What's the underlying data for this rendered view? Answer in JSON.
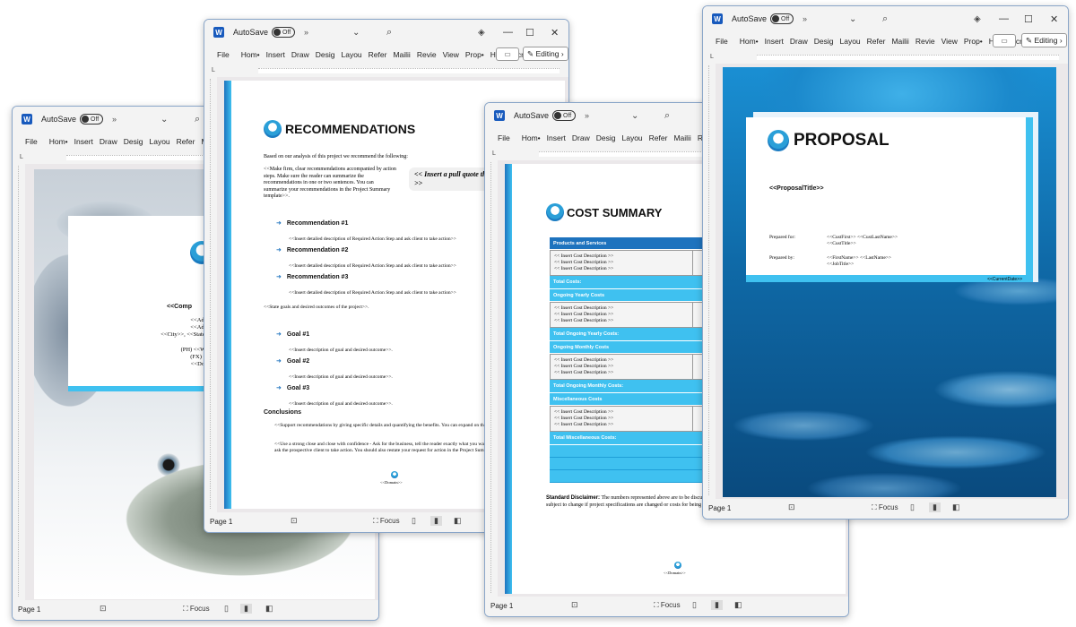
{
  "app": {
    "autosave_label": "AutoSave",
    "autosave_state": "Off",
    "ribbon_tabs": [
      "File",
      "Hom•",
      "Insert",
      "Draw",
      "Desig",
      "Layou",
      "Refer",
      "Mailii",
      "Revie",
      "View",
      "Prop•",
      "Help",
      "Acrol"
    ],
    "editing_label": "Editing",
    "status_page": "Page 1",
    "focus_label": "Focus",
    "accent": "#1e73be",
    "accent_light": "#3fc1f0"
  },
  "windows": {
    "cover": {
      "company": "<<Comp",
      "address_lines": [
        "<<Addre",
        "<<Addre",
        "<<City>>, <<State>>"
      ],
      "contact_lines": [
        "(PH) <<Worl",
        "(FX) <<I",
        "<<Doma"
      ]
    },
    "recommendations": {
      "title": "RECOMMENDATIONS",
      "intro": "Based on our analysis of this project we recommend the following:",
      "paragraph": "<<Make firm, clear recommendations accompanied by action steps.  Make sure the reader can summarize the recommendations in one or two sentences.  You can summarize your recommendations in the Project Summary template>>.",
      "pull_quote": "<< Insert a pull quote that will be in emphasis text >>",
      "recommendations": [
        {
          "label": "Recommendation #1",
          "desc": "<<Insert detailed description of Required Action Step and ask client to take action>>"
        },
        {
          "label": "Recommendation #2",
          "desc": "<<Insert detailed description of Required Action Step and ask client to take action>>"
        },
        {
          "label": "Recommendation #3",
          "desc": "<<Insert detailed description of Required Action Step and ask client to take action>>"
        }
      ],
      "goals_intro": "<<State goals and desired outcomes of the project>>.",
      "goals": [
        {
          "label": "Goal #1",
          "desc": "<<Insert description of goal and desired outcome>>."
        },
        {
          "label": "Goal #2",
          "desc": "<<Insert description of goal and desired outcome>>."
        },
        {
          "label": "Goal #3",
          "desc": "<<Insert description of goal and desired outcome>>."
        }
      ],
      "conclusions_heading": "Conclusions",
      "conclusion_1": "<<Support recommendations by giving specific details and quantifying the benefits.  You can expand on the benefits by adding the Benefits template>>.",
      "conclusion_2": "<<Use a strong close and close with confidence - Ask for the business, tell the reader exactly what you want him or her to do.  Many proposals forget to ask the prospective client to take action. You should also restate your request for action in the Project Summary template>>.",
      "domain": "<<Domain>>"
    },
    "cost_summary": {
      "title": "COST SUMMARY",
      "sections": [
        {
          "header": "Products and Services",
          "items": [
            "<< Insert Cost Description >>",
            "<< Insert Cost Description >>",
            "<< Insert Cost Description >>"
          ],
          "total": "Total Costs:"
        },
        {
          "header": "Ongoing Yearly Costs",
          "items": [
            "<< Insert Cost Description >>",
            "<< Insert Cost Description >>",
            "<< Insert Cost Description >>"
          ],
          "total": "Total Ongoing Yearly Costs:"
        },
        {
          "header": "Ongoing Monthly Costs",
          "items": [
            "<< Insert Cost Description >>",
            "<< Insert Cost Description >>",
            "<< Insert Cost Description >>"
          ],
          "total": "Total Ongoing Monthly Costs:"
        },
        {
          "header": "Miscellaneous Costs",
          "items": [
            "<< Insert Cost Description >>",
            "<< Insert Cost Description >>",
            "<< Insert Cost Description >>"
          ],
          "total": "Total Miscellaneous Costs:"
        }
      ],
      "disclaimer_label": "Standard Disclaimer:",
      "disclaimer_text": "The numbers represented above are to be discussed. The above Cost Summary does in no way constitute a w subject to change if project specifications are changed or costs for being locked in by a binding contract.",
      "domain": "<<Domain>>"
    },
    "proposal": {
      "title": "PROPOSAL",
      "proposal_title": "<<ProposalTitle>>",
      "prepared_for_label": "Prepared for:",
      "prepared_for_lines": [
        "<<CustFirst>> <<CustLastName>>",
        "<<CustTitle>>"
      ],
      "prepared_by_label": "Prepared by:",
      "prepared_by_lines": [
        "<<FirstName>> <<LastName>>",
        "<<JobTitle>>"
      ],
      "date": "<<CurrentDate>>"
    }
  }
}
